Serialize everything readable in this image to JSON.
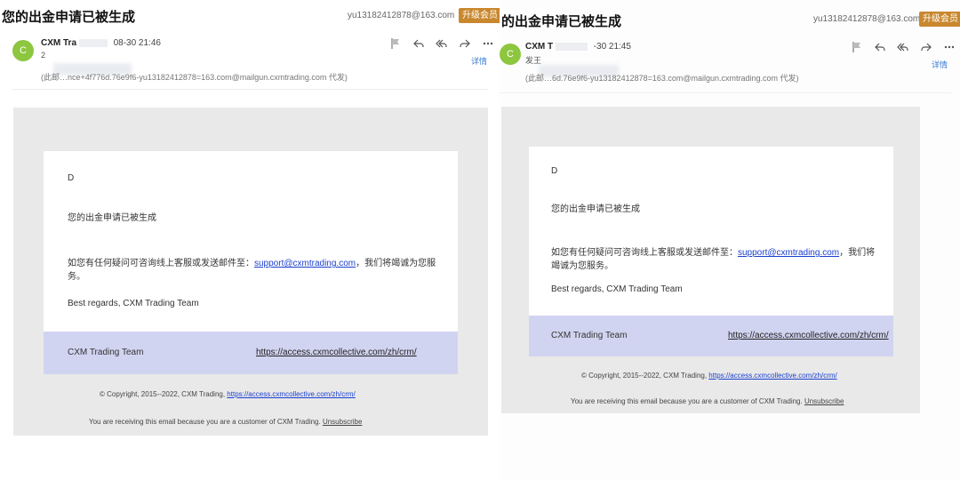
{
  "left": {
    "subject": "您的出金申请已被生成",
    "account_email": "yu13182412878@163.com",
    "vip_badge": "升级会员",
    "avatar_letter": "C",
    "sender_name": "CXM Tra",
    "sent_time": "08-30 21:46",
    "recipient_prefix": "2",
    "proxy_text": "(此邮…nce+4f776d.76e9f6-yu13182412878=163.com@mailgun.cxmtrading.com 代发)",
    "detail_link": "详情",
    "greeting": "D",
    "body_line1": "您的出金申请已被生成",
    "body_para_before": "如您有任何疑问可咨询线上客服或发送邮件至：",
    "support_email": "support@cxmtrading.com",
    "body_para_after": "，我们将竭诚为您服务。",
    "signoff": "Best regards, CXM Trading Team",
    "footer_team": "CXM Trading Team",
    "footer_url": "https://access.cxmcollective.com/zh/crm/",
    "copyright_prefix": "© Copyright, 2015--2022, CXM Trading, ",
    "copyright_link": "https://access.cxmcollective.com/zh/crm/",
    "receiving_text": "You are receiving this email because you are a customer of CXM Trading. ",
    "unsubscribe": "Unsubscribe"
  },
  "right": {
    "subject": "的出金申请已被生成",
    "account_email": "yu13182412878@163.com",
    "vip_badge": "升级会员",
    "avatar_letter": "C",
    "sender_name": "CXM T",
    "sent_time": "-30 21:45",
    "recipient_prefix": "发王",
    "proxy_text": "(此邮…6d.76e9f6-yu13182412878=163.com@mailgun.cxmtrading.com 代发)",
    "detail_link": "详情",
    "greeting": "D",
    "body_line1": "您的出金申请已被生成",
    "body_para_before": "如您有任何疑问可咨询线上客服或发送邮件至：",
    "support_email": "support@cxmtrading.com",
    "body_para_after": "，我们将竭诚为您服务。",
    "signoff": "Best regards, CXM Trading Team",
    "footer_team": "CXM Trading Team",
    "footer_url": "https://access.cxmcollective.com/zh/crm/",
    "copyright_prefix": "© Copyright, 2015--2022, CXM Trading, ",
    "copyright_link": "https://access.cxmcollective.com/zh/crm/",
    "receiving_text": "You are receiving this email because you are a customer of CXM Trading. ",
    "unsubscribe": "Unsubscribe"
  },
  "icons": [
    "flag-icon",
    "reply-icon",
    "reply-all-icon",
    "forward-icon",
    "more-icon"
  ],
  "colors": {
    "avatar": "#8dc63f",
    "vip_badge": "#c9882e",
    "footer_band": "#d1d4f0",
    "link": "#1a3fcf",
    "detail_link": "#3a7bd5",
    "grey_area": "#e9e9e9"
  }
}
